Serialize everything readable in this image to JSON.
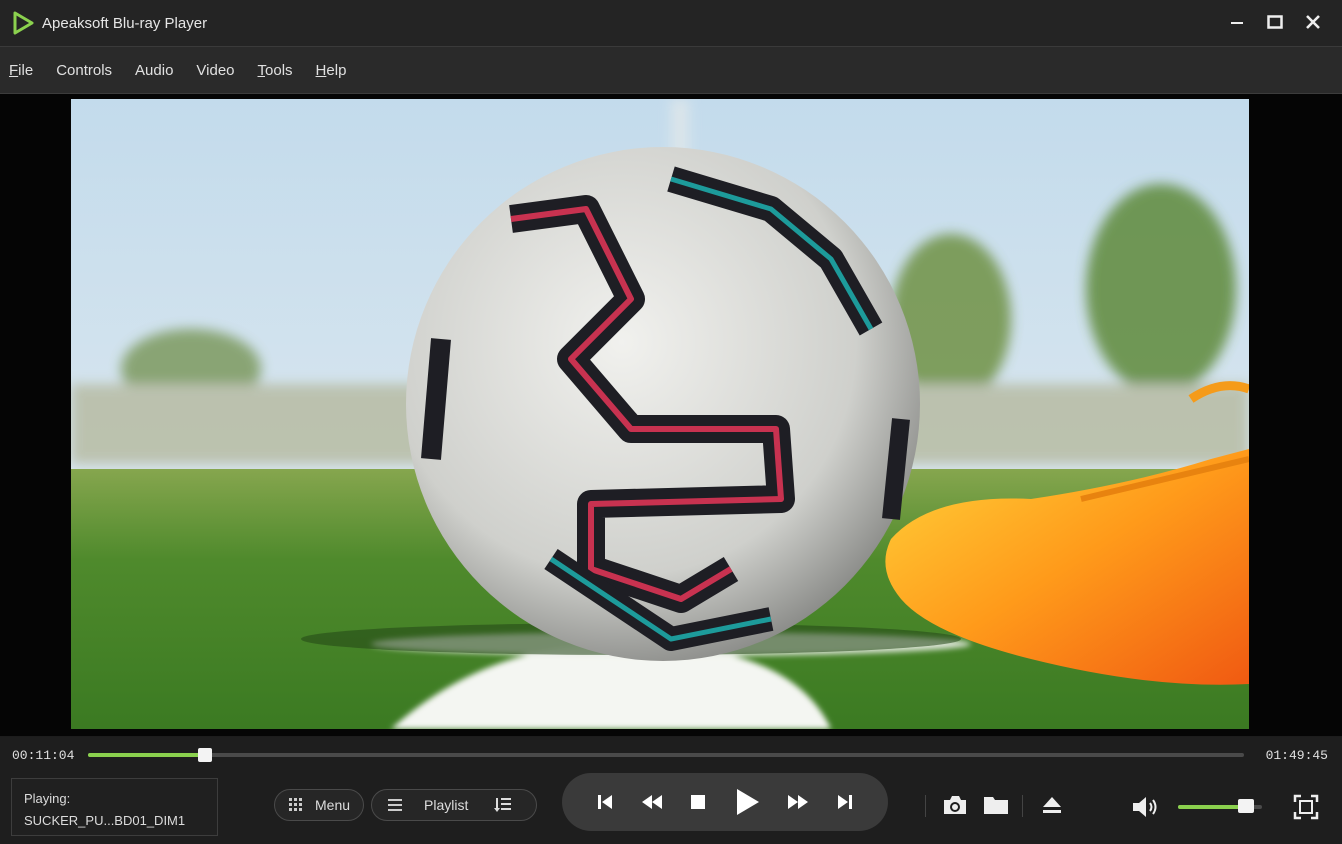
{
  "window": {
    "title": "Apeaksoft Blu-ray Player",
    "accent": "#8bd14e"
  },
  "window_controls": [
    {
      "name": "minimize-icon"
    },
    {
      "name": "maximize-icon"
    },
    {
      "name": "close-icon"
    }
  ],
  "menu": {
    "items": [
      "File",
      "Controls",
      "Audio",
      "Video",
      "Tools",
      "Help"
    ]
  },
  "playback": {
    "current_time": "00:11:04",
    "total_time": "01:49:45",
    "progress_fraction": 0.101,
    "volume_fraction": 0.81,
    "state": "playing"
  },
  "now_playing": {
    "label": "Playing:",
    "title": "SUCKER_PU...BD01_DIM1"
  },
  "buttons": {
    "menu_label": "Menu",
    "playlist_label": "Playlist"
  },
  "icons": {
    "transport": [
      "skip-previous-icon",
      "rewind-icon",
      "stop-icon",
      "play-icon",
      "fast-forward-icon",
      "skip-next-icon"
    ],
    "tools": [
      "snapshot-icon",
      "open-folder-icon",
      "eject-icon",
      "volume-icon",
      "fullscreen-icon"
    ]
  }
}
